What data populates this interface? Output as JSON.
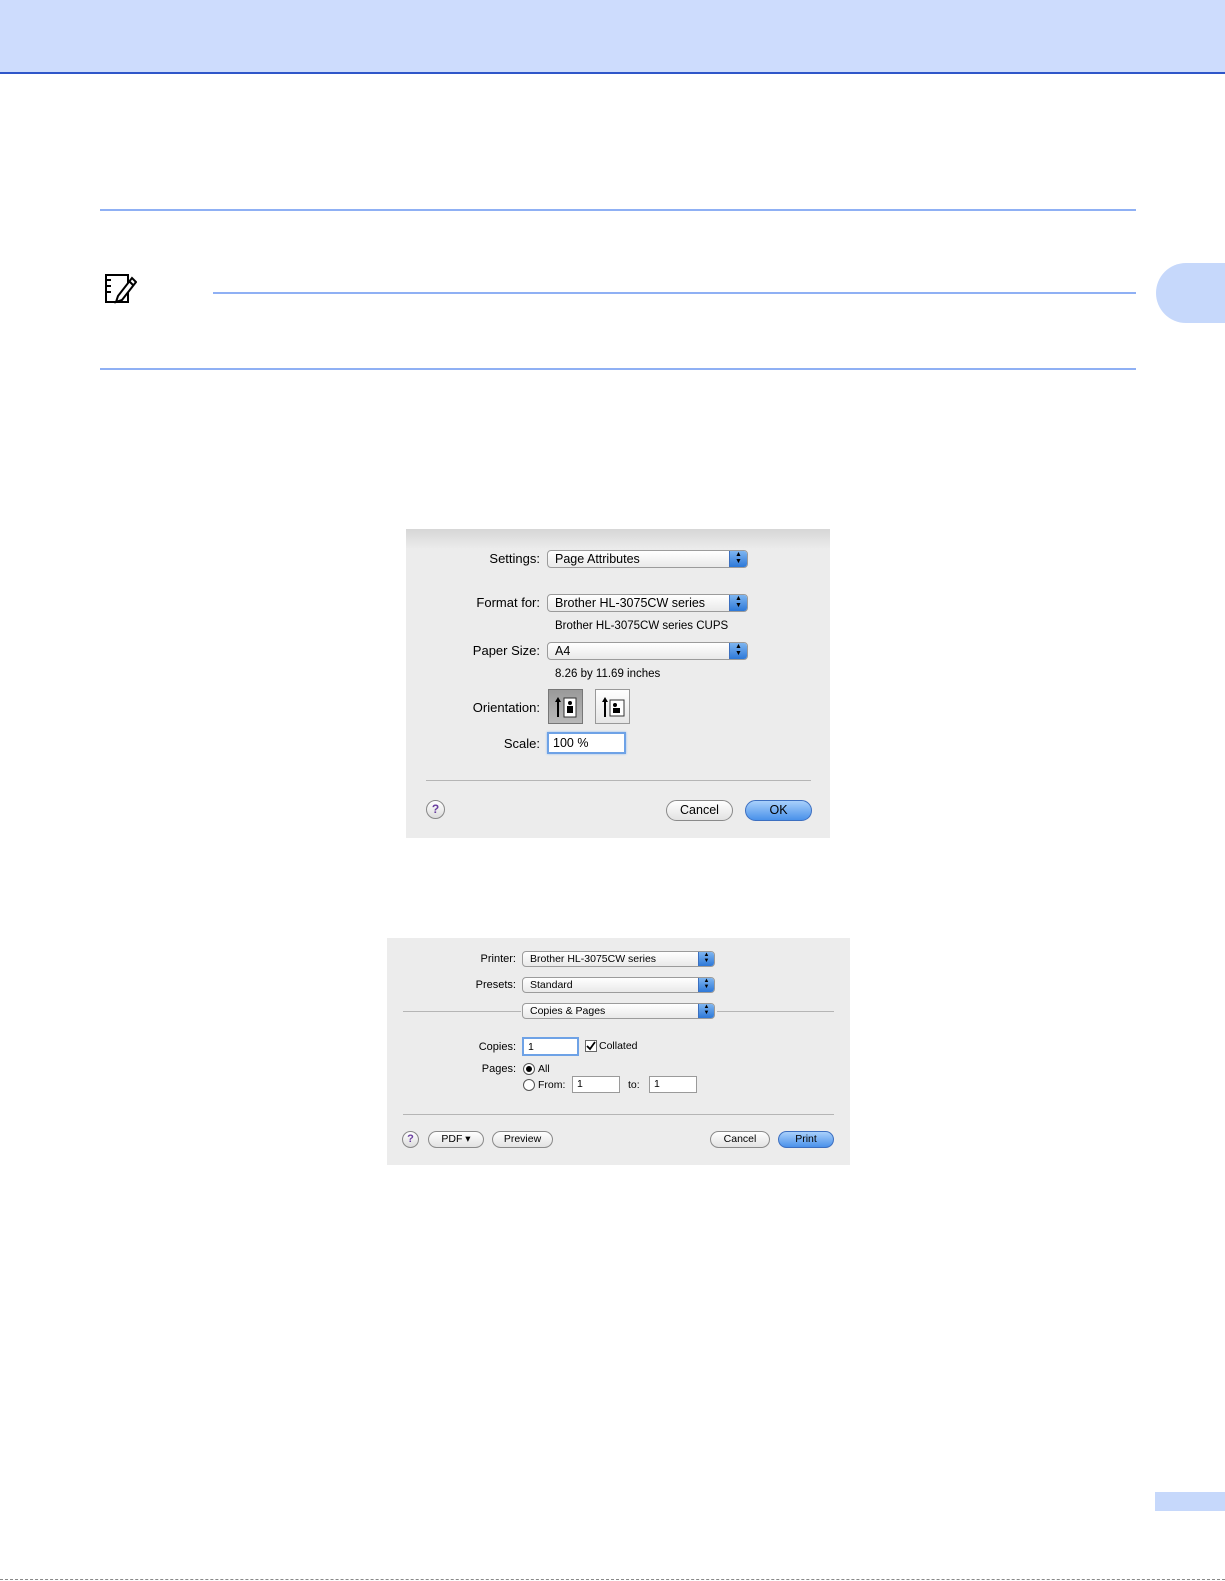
{
  "page_setup_dialog": {
    "settings_label": "Settings:",
    "settings_value": "Page Attributes",
    "format_for_label": "Format for:",
    "format_for_value": "Brother HL-3075CW series",
    "format_for_sub": "Brother HL-3075CW series CUPS",
    "paper_size_label": "Paper Size:",
    "paper_size_value": "A4",
    "paper_size_sub": "8.26 by 11.69 inches",
    "orientation_label": "Orientation:",
    "scale_label": "Scale:",
    "scale_value": "100 %",
    "help_glyph": "?",
    "cancel_label": "Cancel",
    "ok_label": "OK"
  },
  "print_dialog": {
    "printer_label": "Printer:",
    "printer_value": "Brother HL-3075CW series",
    "presets_label": "Presets:",
    "presets_value": "Standard",
    "panel_value": "Copies & Pages",
    "copies_label": "Copies:",
    "copies_value": "1",
    "collated_label": "Collated",
    "pages_label": "Pages:",
    "all_label": "All",
    "from_label": "From:",
    "from_value": "1",
    "to_label": "to:",
    "to_value": "1",
    "help_glyph": "?",
    "pdf_label": "PDF ▾",
    "preview_label": "Preview",
    "cancel_label": "Cancel",
    "print_label": "Print"
  },
  "colors": {
    "top_band": "#cddcfd",
    "accent_line": "#8fb0f4",
    "primary_button": "#4a91ea"
  }
}
